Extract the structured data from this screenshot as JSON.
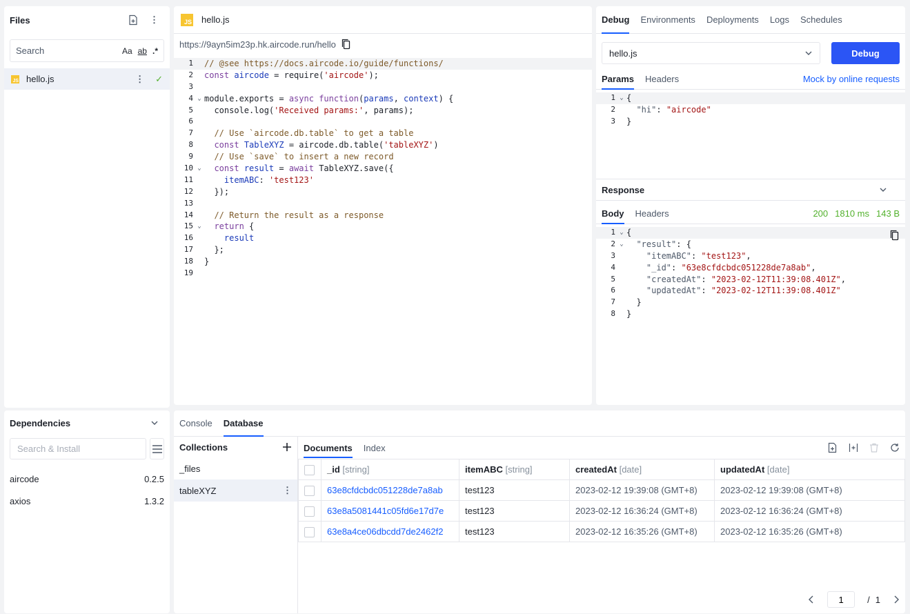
{
  "files": {
    "title": "Files",
    "search_placeholder": "Search",
    "opt_case": "Aa",
    "opt_word": "ab",
    "opt_regex": ".*",
    "items": [
      {
        "name": "hello.js"
      }
    ]
  },
  "dependencies": {
    "title": "Dependencies",
    "search_placeholder": "Search & Install",
    "items": [
      {
        "name": "aircode",
        "version": "0.2.5"
      },
      {
        "name": "axios",
        "version": "1.3.2"
      }
    ]
  },
  "editor": {
    "tab_label": "hello.js",
    "js_badge": "JS",
    "url": "https://9ayn5im23p.hk.aircode.run/hello",
    "lines": [
      {
        "n": "1",
        "fold": "",
        "html": "<span style='color:#7d5a29'>// @see https://docs.aircode.io/guide/functions/</span>"
      },
      {
        "n": "2",
        "fold": "",
        "html": "<span style='color:#7a3e9d'>const</span> <span style='color:#1a3ab8'>aircode</span> = require(<span style='color:#a31515'>'aircode'</span>);"
      },
      {
        "n": "3",
        "fold": "",
        "html": ""
      },
      {
        "n": "4",
        "fold": "⌄",
        "html": "module.exports = <span style='color:#7a3e9d'>async</span> <span style='color:#7a3e9d'>function</span>(<span style='color:#1a3ab8'>params</span>, <span style='color:#1a3ab8'>context</span>) {"
      },
      {
        "n": "5",
        "fold": "",
        "html": "  console.log(<span style='color:#a31515'>'Received params:'</span>, params);"
      },
      {
        "n": "6",
        "fold": "",
        "html": ""
      },
      {
        "n": "7",
        "fold": "",
        "html": "  <span style='color:#7d5a29'>// Use `aircode.db.table` to get a table</span>"
      },
      {
        "n": "8",
        "fold": "",
        "html": "  <span style='color:#7a3e9d'>const</span> <span style='color:#1a3ab8'>TableXYZ</span> = aircode.db.table(<span style='color:#a31515'>'tableXYZ'</span>)"
      },
      {
        "n": "9",
        "fold": "",
        "html": "  <span style='color:#7d5a29'>// Use `save` to insert a new record</span>"
      },
      {
        "n": "10",
        "fold": "⌄",
        "html": "  <span style='color:#7a3e9d'>const</span> <span style='color:#1a3ab8'>result</span> = <span style='color:#7a3e9d'>await</span> TableXYZ.save({"
      },
      {
        "n": "11",
        "fold": "",
        "html": "    <span style='color:#1a3ab8'>itemABC</span>: <span style='color:#a31515'>'test123'</span>"
      },
      {
        "n": "12",
        "fold": "",
        "html": "  });"
      },
      {
        "n": "13",
        "fold": "",
        "html": ""
      },
      {
        "n": "14",
        "fold": "",
        "html": "  <span style='color:#7d5a29'>// Return the result as a response</span>"
      },
      {
        "n": "15",
        "fold": "⌄",
        "html": "  <span style='color:#7a3e9d'>return</span> {"
      },
      {
        "n": "16",
        "fold": "",
        "html": "    <span style='color:#1a3ab8'>result</span>"
      },
      {
        "n": "17",
        "fold": "",
        "html": "  };"
      },
      {
        "n": "18",
        "fold": "",
        "html": "}"
      },
      {
        "n": "19",
        "fold": "",
        "html": ""
      }
    ]
  },
  "debug": {
    "tabs": [
      "Debug",
      "Environments",
      "Deployments",
      "Logs",
      "Schedules"
    ],
    "selected_file": "hello.js",
    "debug_button": "Debug",
    "param_tabs": [
      "Params",
      "Headers"
    ],
    "mock_link": "Mock by online requests",
    "params_lines": [
      {
        "n": "1",
        "fold": "⌄",
        "html": "{"
      },
      {
        "n": "2",
        "fold": "",
        "html": "  <span style='color:#4e5969'>\"hi\"</span>: <span style='color:#a31515'>\"aircode\"</span>"
      },
      {
        "n": "3",
        "fold": "",
        "html": "}"
      }
    ],
    "response_title": "Response",
    "response_tabs": [
      "Body",
      "Headers"
    ],
    "status_code": "200",
    "duration": "1810 ms",
    "size": "143 B",
    "response_lines": [
      {
        "n": "1",
        "fold": "⌄",
        "html": "{"
      },
      {
        "n": "2",
        "fold": "⌄",
        "html": "  <span style='color:#4e5969'>\"result\"</span>: {"
      },
      {
        "n": "3",
        "fold": "",
        "html": "    <span style='color:#4e5969'>\"itemABC\"</span>: <span style='color:#a31515'>\"test123\"</span>,"
      },
      {
        "n": "4",
        "fold": "",
        "html": "    <span style='color:#4e5969'>\"_id\"</span>: <span style='color:#a31515'>\"63e8cfdcbdc051228de7a8ab\"</span>,"
      },
      {
        "n": "5",
        "fold": "",
        "html": "    <span style='color:#4e5969'>\"createdAt\"</span>: <span style='color:#a31515'>\"2023-02-12T11:39:08.401Z\"</span>,"
      },
      {
        "n": "6",
        "fold": "",
        "html": "    <span style='color:#4e5969'>\"updatedAt\"</span>: <span style='color:#a31515'>\"2023-02-12T11:39:08.401Z\"</span>"
      },
      {
        "n": "7",
        "fold": "",
        "html": "  }"
      },
      {
        "n": "8",
        "fold": "",
        "html": "}"
      }
    ]
  },
  "bottom": {
    "tabs": [
      "Console",
      "Database"
    ],
    "collections_title": "Collections",
    "collections": [
      "_files",
      "tableXYZ"
    ],
    "doc_tabs": [
      "Documents",
      "Index"
    ],
    "columns": [
      {
        "name": "_id",
        "type": "[string]"
      },
      {
        "name": "itemABC",
        "type": "[string]"
      },
      {
        "name": "createdAt",
        "type": "[date]"
      },
      {
        "name": "updatedAt",
        "type": "[date]"
      }
    ],
    "rows": [
      {
        "id": "63e8cfdcbdc051228de7a8ab",
        "itemABC": "test123",
        "createdAt": "2023-02-12 19:39:08 (GMT+8)",
        "updatedAt": "2023-02-12 19:39:08 (GMT+8)"
      },
      {
        "id": "63e8a5081441c05fd6e17d7e",
        "itemABC": "test123",
        "createdAt": "2023-02-12 16:36:24 (GMT+8)",
        "updatedAt": "2023-02-12 16:36:24 (GMT+8)"
      },
      {
        "id": "63e8a4ce06dbcdd7de2462f2",
        "itemABC": "test123",
        "createdAt": "2023-02-12 16:35:26 (GMT+8)",
        "updatedAt": "2023-02-12 16:35:26 (GMT+8)"
      }
    ],
    "page": "1",
    "page_sep": "/",
    "total_pages": "1"
  }
}
